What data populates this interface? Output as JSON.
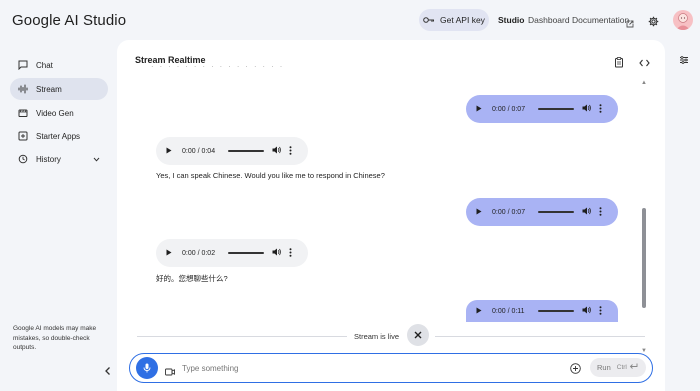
{
  "header": {
    "app_title": "Google AI Studio",
    "api_key_label": "Get API key",
    "nav": [
      "Studio",
      "Dashboard",
      "Documentation"
    ]
  },
  "sidebar": {
    "items": [
      {
        "label": "Chat",
        "icon": "chat-icon",
        "active": false
      },
      {
        "label": "Stream",
        "icon": "waveform-icon",
        "active": true
      },
      {
        "label": "Video Gen",
        "icon": "video-icon",
        "active": false
      },
      {
        "label": "Starter Apps",
        "icon": "apps-icon",
        "active": false
      },
      {
        "label": "History",
        "icon": "history-icon",
        "active": false
      }
    ],
    "footnote": "Google AI models may make mistakes, so double-check outputs."
  },
  "panel": {
    "title": "Stream Realtime",
    "messages": [
      {
        "role": "user",
        "time": "0:00 / 0:07"
      },
      {
        "role": "model",
        "time": "0:00 / 0:04",
        "text": "Yes, I can speak Chinese. Would you like me to respond in Chinese?"
      },
      {
        "role": "user",
        "time": "0:00 / 0:07"
      },
      {
        "role": "model",
        "time": "0:00 / 0:02",
        "text": "好的。您想聊些什么?"
      },
      {
        "role": "user",
        "time": "0:00 / 0:11"
      }
    ],
    "status_label": "Stream is live"
  },
  "input": {
    "placeholder": "Type something",
    "run_label": "Run",
    "shortcut": "Ctrl"
  },
  "colors": {
    "user_bubble": "#a9b3f4",
    "model_bubble": "#f1f2f4",
    "accent": "#2f6fe4"
  }
}
